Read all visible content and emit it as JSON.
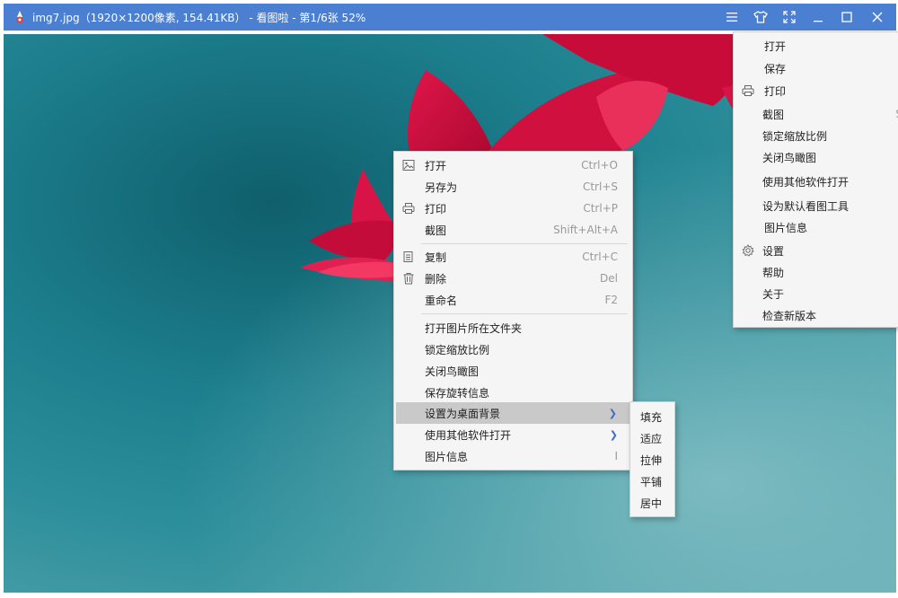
{
  "titlebar": {
    "title": "img7.jpg（1920×1200像素, 154.41KB） - 看图啦 - 第1/6张 52%",
    "bg_color": "#4a7fd1"
  },
  "context_menu": {
    "items": [
      {
        "label": "打开",
        "shortcut": "Ctrl+O",
        "icon": "image-icon"
      },
      {
        "label": "另存为",
        "shortcut": "Ctrl+S"
      },
      {
        "label": "打印",
        "shortcut": "Ctrl+P",
        "icon": "printer-icon"
      },
      {
        "label": "截图",
        "shortcut": "Shift+Alt+A"
      },
      {
        "label": "复制",
        "shortcut": "Ctrl+C",
        "icon": "copy-icon"
      },
      {
        "label": "删除",
        "shortcut": "Del",
        "icon": "trash-icon"
      },
      {
        "label": "重命名",
        "shortcut": "F2"
      },
      {
        "label": "打开图片所在文件夹"
      },
      {
        "label": "锁定缩放比例"
      },
      {
        "label": "关闭鸟瞰图"
      },
      {
        "label": "保存旋转信息"
      },
      {
        "label": "设置为桌面背景",
        "submenu": true,
        "highlighted": true
      },
      {
        "label": "使用其他软件打开",
        "submenu": true
      },
      {
        "label": "图片信息",
        "shortcut": "I"
      }
    ]
  },
  "wallpaper_submenu": {
    "items": [
      "填充",
      "适应",
      "拉伸",
      "平铺",
      "居中"
    ]
  },
  "main_menu": {
    "items": [
      {
        "label": "打开"
      },
      {
        "label": "保存"
      },
      {
        "label": "打印",
        "icon": "printer-icon"
      },
      {
        "label": "截图",
        "shortcut": "S"
      },
      {
        "label": "锁定缩放比例"
      },
      {
        "label": "关闭鸟瞰图"
      },
      {
        "label": "使用其他软件打开"
      },
      {
        "label": "设为默认看图工具"
      },
      {
        "label": "图片信息"
      },
      {
        "label": "设置",
        "icon": "gear-icon"
      },
      {
        "label": "帮助"
      },
      {
        "label": "关于"
      },
      {
        "label": "检查新版本"
      }
    ]
  }
}
